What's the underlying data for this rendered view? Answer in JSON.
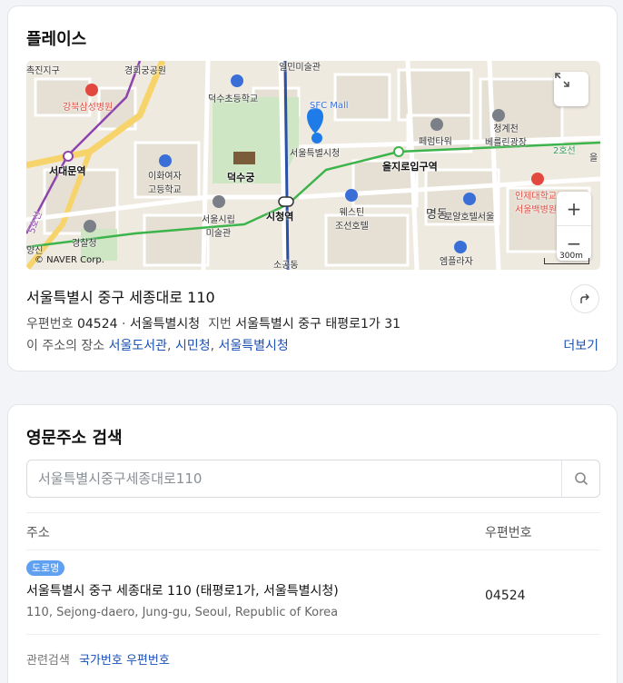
{
  "place_card": {
    "title": "플레이스",
    "map": {
      "labels": {
        "l1": "촉진지구",
        "l2": "경희궁공원",
        "l3": "일민미술관",
        "l4": "강북삼성병원",
        "l5": "덕수초등학교",
        "l6": "SFC Mall",
        "l7": "서울특별시청",
        "l8": "청계천\n베를린광장",
        "l9": "페럼타워",
        "l10": "서대문역",
        "l11": "이화여자\n고등학교",
        "l12": "덕수궁",
        "l13": "을지로입구역",
        "l14": "2호선",
        "l15": "인제대학교\n서울백병원",
        "l16": "서울시립\n미술관",
        "l17": "시청역",
        "l18": "웨스틴\n조선호텔",
        "l19": "명동",
        "l20": "로얄호텔서울",
        "l21": "경찰청",
        "l22": "소공동",
        "l23": "5호선",
        "l24": "엠플라자",
        "l25": "을",
        "l26": "양신"
      },
      "copyright": "© NAVER Corp.",
      "scale": "300m",
      "zoom_in": "+",
      "zoom_out": "−",
      "colors": {
        "line2": "#3cb44b",
        "line1": "#2b50a8",
        "line5": "#8e44ad",
        "road_yellow": "#f7d46b",
        "park": "#cfe6c5",
        "marker": "#1e7be8"
      }
    },
    "address": "서울특별시 중구 세종대로 110",
    "zip_label": "우편번호",
    "zip": "04524",
    "sep": " · ",
    "building": "서울특별시청",
    "jibun_label": "지번",
    "jibun": "서울특별시 중구 태평로1가 31",
    "places_label": "이 주소의 장소",
    "places": [
      "서울도서관",
      "시민청",
      "서울특별시청"
    ],
    "more": "더보기"
  },
  "english_card": {
    "title": "영문주소 검색",
    "search_placeholder": "서울특별시중구세종대로110",
    "col_address": "주소",
    "col_zip": "우편번호",
    "row": {
      "badge": "도로명",
      "korean": "서울특별시 중구 세종대로 110 (태평로1가, 서울특별시청)",
      "english": "110, Sejong-daero, Jung-gu, Seoul, Republic of Korea",
      "zip": "04524"
    },
    "related_label": "관련검색",
    "related_links": [
      "국가번호",
      "우편번호"
    ]
  }
}
